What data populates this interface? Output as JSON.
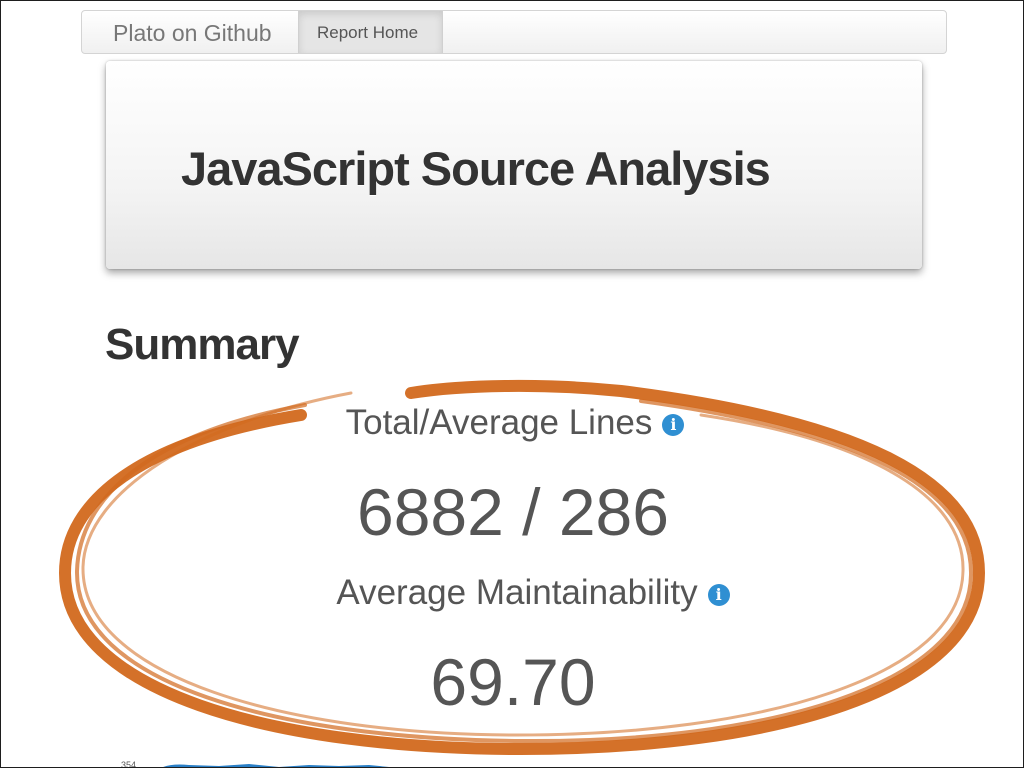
{
  "navbar": {
    "brand": "Plato on Github",
    "active_link": "Report Home"
  },
  "hero": {
    "title": "JavaScript Source Analysis"
  },
  "summary": {
    "heading": "Summary",
    "lines_label": "Total/Average Lines",
    "lines_value": "6882 / 286",
    "maintainability_label": "Average Maintainability",
    "maintainability_value": "69.70",
    "info_icon_glyph": "i",
    "chart_peek_text": "354"
  },
  "colors": {
    "annotation": "#d2691e",
    "info_icon": "#2f8fd2",
    "text": "#555555",
    "heading": "#333333"
  }
}
